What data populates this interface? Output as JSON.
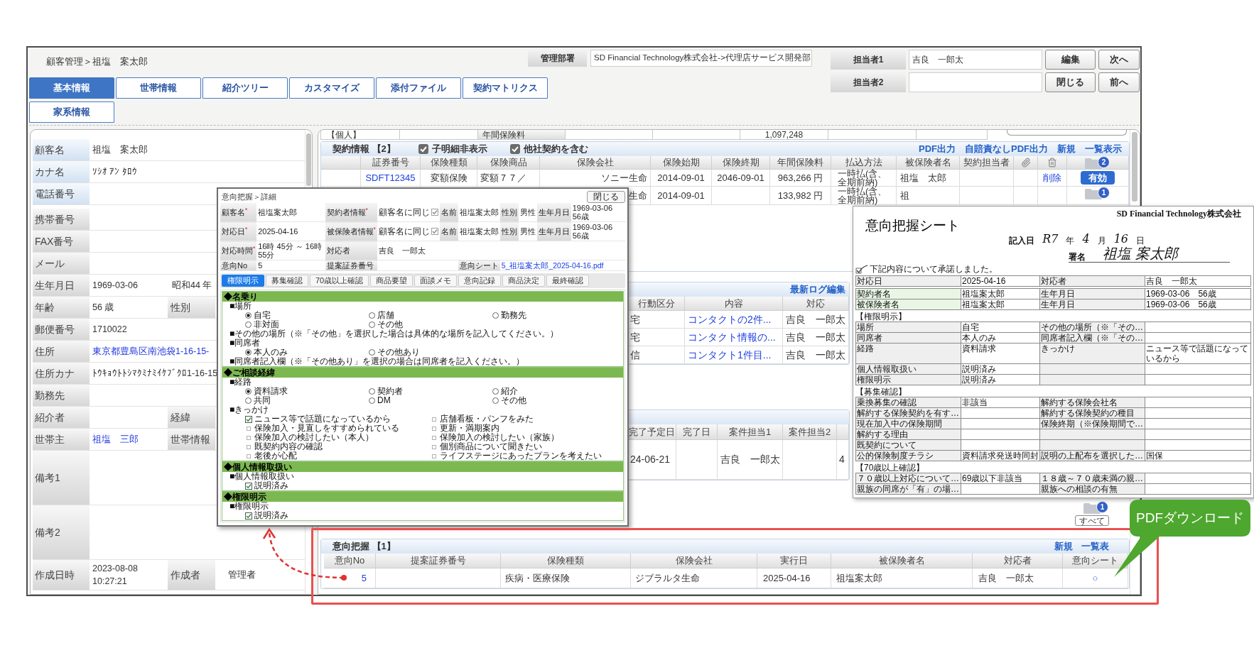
{
  "breadcrumb": "顧客管理＞祖塩　案太郎",
  "department": {
    "label": "管理部署",
    "value": "SD Financial Technology株式会社->代理店サービス開発部"
  },
  "staff": [
    {
      "label": "担当者1",
      "value": "吉良　一郎太"
    },
    {
      "label": "担当者2"
    }
  ],
  "buttons": [
    "編集",
    "次へ",
    "閉じる",
    "前へ"
  ],
  "tabs": [
    {
      "label": "基本情報",
      "selected": true
    },
    {
      "label": "世帯情報",
      "selected": false
    },
    {
      "label": "紹介ツリー",
      "selected": false
    },
    {
      "label": "カスタマイズ",
      "selected": false
    },
    {
      "label": "添付ファイル",
      "selected": false
    },
    {
      "label": "契約マトリクス",
      "selected": false
    },
    {
      "label": "家系情報",
      "selected": false
    }
  ],
  "customer": {
    "rows": [
      {
        "label": "顧客名",
        "kind": "field",
        "highlighted": true,
        "value": "祖塩　案太郎",
        "link": false
      },
      {
        "label": "カナ名",
        "kind": "field",
        "highlighted": true,
        "value": "ｿｼｵ ｱﾝ ﾀﾛｳ",
        "link": false
      },
      {
        "label": "電話番号",
        "kind": "field",
        "highlighted": true
      },
      {
        "label": "携帯番号",
        "kind": "field",
        "highlighted": false
      },
      {
        "label": "FAX番号",
        "kind": "field",
        "highlighted": false
      },
      {
        "label": "メール",
        "kind": "field",
        "highlighted": false
      },
      {
        "label": "生年月日",
        "kind": "field",
        "highlighted": false,
        "value": "1969-03-06",
        "link": false,
        "second_value": "昭和44 年"
      },
      {
        "label": "年齢",
        "kind": "field",
        "highlighted": false,
        "value": "56 歳",
        "link": false,
        "second_label": "性別"
      },
      {
        "label": "郵便番号",
        "kind": "field",
        "highlighted": false,
        "value": "1710022",
        "link": false
      },
      {
        "label": "住所",
        "kind": "field",
        "highlighted": false,
        "value": "東京都豊島区南池袋1-16-15-",
        "link": true
      },
      {
        "label": "住所カナ",
        "kind": "field",
        "highlighted": false,
        "value": "ﾄｳｷｮｳﾄﾄｼﾏｸﾐﾅﾐｲｹﾌﾞｸﾛ1-16-15",
        "link": false
      },
      {
        "label": "勤務先",
        "kind": "field",
        "highlighted": false
      },
      {
        "label": "紹介者",
        "kind": "field",
        "highlighted": false,
        "second_label": "経緯"
      },
      {
        "label": "世帯主",
        "kind": "field",
        "highlighted": false,
        "value": "祖塩　三郎",
        "link": true,
        "second_label": "世帯情報"
      },
      {
        "label": "備考1",
        "kind": "note",
        "highlighted": false
      },
      {
        "label": "備考2",
        "kind": "note",
        "highlighted": false
      },
      {
        "label": "作成日時",
        "kind": "field",
        "highlighted": false,
        "value": "2023-08-08 10:27:21",
        "link": false,
        "second_label": "作成者",
        "second_value": "管理者"
      }
    ]
  },
  "summary": {
    "category": "【個人】",
    "premium_label": "年間保険料",
    "premium_total": "1,097,248"
  },
  "contracts": {
    "title": "契約情報 【2】",
    "options": [
      {
        "label": "子明細非表示",
        "checked": true
      },
      {
        "label": "他社契約を含む",
        "checked": true
      }
    ],
    "links": [
      "PDF出力",
      "自賠責なしPDF出力",
      "新規",
      "一覧表示"
    ],
    "columns": [
      "証券番号",
      "保険種類",
      "保険商品",
      "保険会社",
      "保険始期",
      "保険終期",
      "年間保険料",
      "払込方法",
      "被保険者名",
      "契約担当者"
    ],
    "count_badge": "2",
    "rows": [
      {
        "policy_no": "SDFT12345",
        "type": "変額保険",
        "product": "変額７７／",
        "company": "ソニー生命",
        "start": "2014-09-01",
        "end": "2046-09-01",
        "premium": "963,266 円",
        "payment": "一時払(含、全期前納)",
        "insured": "祖塩　太郎",
        "action": "削除",
        "status": "有効"
      },
      {
        "company": "生命",
        "start": "2014-09-01",
        "premium": "133,982 円",
        "payment": "一時払(含、全期前納)",
        "insured": "祖",
        "badge": "1"
      }
    ]
  },
  "activity_log": {
    "link": "最新ログ編集",
    "columns": [
      "行動区分",
      "内容",
      "対応"
    ],
    "rows": [
      {
        "type": "宅",
        "content": "コンタクトの2件...",
        "staff": "吉良　一郎太"
      },
      {
        "type": "宅",
        "content": "コンタクト情報の...",
        "staff": "吉良　一郎太"
      },
      {
        "type": "信",
        "content": "コンタクト1件目...",
        "staff": "吉良　一郎太"
      }
    ]
  },
  "cases": {
    "columns": [
      "完了予定日",
      "完了日",
      "案件担当1",
      "案件担当2"
    ],
    "rows": [
      {
        "planned": "24-06-21",
        "staff1": "吉良　一郎太",
        "column_5": "4"
      }
    ],
    "badge": "1",
    "all_button": "すべて"
  },
  "intentions": {
    "title": "意向把握 【1】",
    "links": [
      "新規",
      "一覧表"
    ],
    "columns": [
      "意向No",
      "提案証券番号",
      "保険種類",
      "保険会社",
      "実行日",
      "被保険者名",
      "対応者",
      "意向シート"
    ],
    "rows": [
      {
        "no": "5",
        "type": "疾病・医療保険",
        "company": "ジブラルタ生命",
        "date": "2025-04-16",
        "insured": "祖塩案太郎",
        "staff": "吉良　一郎太",
        "sheet": "○"
      }
    ]
  },
  "detail": {
    "breadcrumb": "意向把握＞詳細",
    "close": "閉じる",
    "info": [
      [
        {
          "kind": "label",
          "text": "顧客名$^{*}$"
        },
        {
          "kind": "value",
          "text": "祖塩案太郎"
        },
        {
          "kind": "label",
          "text": "契約者情報$^{*}$"
        },
        {
          "kind": "check",
          "text": "顧客名に同じ",
          "checked": true
        },
        {
          "kind": "label",
          "text": "名前"
        },
        {
          "kind": "value",
          "text": "祖塩案太郎"
        },
        {
          "kind": "label",
          "text": "性別"
        },
        {
          "kind": "value",
          "text": "男性"
        },
        {
          "kind": "label",
          "text": "生年月日"
        },
        {
          "kind": "value",
          "text": "1969-03-06　56歳"
        }
      ],
      [
        {
          "kind": "label",
          "text": "対応日$^{*}$"
        },
        {
          "kind": "value",
          "text": "2025-04-16"
        },
        {
          "kind": "label",
          "text": "被保険者情報$^{*}$"
        },
        {
          "kind": "check",
          "text": "顧客名に同じ",
          "checked": true
        },
        {
          "kind": "label",
          "text": "名前"
        },
        {
          "kind": "value",
          "text": "祖塩案太郎"
        },
        {
          "kind": "label",
          "text": "性別"
        },
        {
          "kind": "value",
          "text": "男性"
        },
        {
          "kind": "label",
          "text": "生年月日"
        },
        {
          "kind": "value",
          "text": "1969-03-06　56歳"
        }
      ],
      [
        {
          "kind": "label",
          "text": "対応時間$^{*}$"
        },
        {
          "kind": "value",
          "text": "16時 45分 ～ 16時 55分"
        },
        {
          "kind": "label",
          "text": "対応者"
        },
        {
          "kind": "value",
          "text": "吉良　一郎太"
        }
      ],
      [
        {
          "kind": "label",
          "text": "意向No"
        },
        {
          "kind": "value",
          "text": "5"
        },
        {
          "kind": "label",
          "text": "提案証券番号"
        },
        {
          "kind": "blank"
        },
        {
          "kind": "blank"
        },
        {
          "kind": "label",
          "text": "意向シート"
        },
        {
          "kind": "link",
          "text": "5_祖塩案太郎_2025-04-16.pdf"
        }
      ]
    ],
    "tabs": [
      {
        "label": "権限明示",
        "selected": true
      },
      {
        "label": "募集確認",
        "selected": false
      },
      {
        "label": "70歳以上確認",
        "selected": false
      },
      {
        "label": "商品要望",
        "selected": false
      },
      {
        "label": "面談メモ",
        "selected": false
      },
      {
        "label": "意向記録",
        "selected": false
      },
      {
        "label": "商品決定",
        "selected": false
      },
      {
        "label": "最終確認",
        "selected": false
      }
    ],
    "sections": [
      {
        "title": "◆名乗り",
        "items": [
          {
            "kind": "heading",
            "text": "■場所"
          },
          {
            "kind": "radios",
            "options": [
              {
                "label": "自宅",
                "selected": true
              },
              {
                "label": "店舗",
                "selected": false
              },
              {
                "label": "勤務先",
                "selected": false
              },
              {
                "label": "非対面",
                "selected": false
              },
              {
                "label": "その他",
                "selected": false
              }
            ]
          },
          {
            "kind": "heading",
            "text": "■その他の場所（※「その他」を選択した場合は具体的な場所を記入してください。）"
          },
          {
            "kind": "heading",
            "text": "■同席者"
          },
          {
            "kind": "radios",
            "options": [
              {
                "label": "本人のみ",
                "selected": true
              },
              {
                "label": "その他あり",
                "selected": false
              }
            ]
          },
          {
            "kind": "heading",
            "text": "■同席者記入欄（※「その他あり」を選択の場合は同席者を記入ください。）"
          }
        ]
      },
      {
        "title": "◆ご相談経緯",
        "items": [
          {
            "kind": "heading",
            "text": "■経路"
          },
          {
            "kind": "radios",
            "options": [
              {
                "label": "資料請求",
                "selected": true
              },
              {
                "label": "契約者",
                "selected": false
              },
              {
                "label": "紹介",
                "selected": false
              },
              {
                "label": "共同",
                "selected": false
              },
              {
                "label": "DM",
                "selected": false
              },
              {
                "label": "その他",
                "selected": false
              }
            ]
          },
          {
            "kind": "heading",
            "text": "■きっかけ"
          },
          {
            "kind": "checks",
            "options": [
              {
                "label": "ニュース等で話題になっているから",
                "checked": true
              },
              {
                "label": "店舗看板・パンフをみた",
                "checked": false
              },
              {
                "label": "保険加入・見直しをすすめられている",
                "checked": false
              },
              {
                "label": "更新・満期案内",
                "checked": false
              },
              {
                "label": "保険加入の検討したい（本人）",
                "checked": false
              },
              {
                "label": "保険加入の検討したい（家族）",
                "checked": false
              },
              {
                "label": "既契約内容の確認",
                "checked": false
              },
              {
                "label": "個別商品について聞きたい",
                "checked": false
              },
              {
                "label": "老後が心配",
                "checked": false
              },
              {
                "label": "ライフステージにあったプランを考えたい",
                "checked": false
              }
            ]
          }
        ]
      },
      {
        "title": "◆個人情報取扱い",
        "items": [
          {
            "kind": "heading",
            "text": "■個人情報取扱い"
          },
          {
            "kind": "checks",
            "options": [
              {
                "label": "説明済み",
                "checked": true
              }
            ]
          }
        ]
      },
      {
        "title": "◆権限明示",
        "items": [
          {
            "kind": "heading",
            "text": "■権限明示"
          },
          {
            "kind": "checks",
            "options": [
              {
                "label": "説明済み",
                "checked": true
              }
            ]
          }
        ]
      }
    ]
  },
  "sheet": {
    "company": "SD Financial Technology株式会社",
    "title": "意向把握シート",
    "date": {
      "label": "記入日",
      "parts": [
        {
          "hand": "R7",
          "unit": "年"
        },
        {
          "hand": "4",
          "unit": "月"
        },
        {
          "hand": "16",
          "unit": "日"
        }
      ]
    },
    "signature": {
      "label": "署名",
      "hand": "祖塩 案太郎"
    },
    "consent": {
      "text": "下記内容について承諾しました。",
      "checked": true
    },
    "tables": [
      {
        "tinted": false,
        "rows": [
          [
            "対応日",
            "2025-04-16",
            "対応者",
            "吉良　一郎太"
          ]
        ]
      },
      {
        "tinted": true,
        "rows": [
          [
            "契約者名",
            "祖塩案太郎",
            "生年月日",
            "1969-03-06　56歳"
          ],
          [
            "被保険者名",
            "祖塩案太郎",
            "生年月日",
            "1969-03-06　56歳"
          ]
        ]
      },
      {
        "tinted": false,
        "heading": "【権限明示】",
        "rows": [
          [
            "場所",
            "自宅",
            "その他の場所（※「その…",
            null
          ],
          [
            "同席者",
            "本人のみ",
            "同席者記入欄（※「その…",
            null
          ],
          [
            "経路",
            "資料請求",
            "きっかけ",
            "ニュース等で話題になっているから"
          ],
          [
            "個人情報取扱い",
            "説明済み",
            null,
            null
          ],
          [
            "権限明示",
            "説明済み",
            null,
            null
          ]
        ]
      },
      {
        "tinted": false,
        "heading": "【募集確認】",
        "rows": [
          [
            "乗換募集の確認",
            "非該当",
            "解約する保険会社名",
            null
          ],
          [
            "解約する保険契約を有す…",
            null,
            "解約する保険契約の種目",
            null
          ],
          [
            "現在加入中の保険期間",
            null,
            "保険終期（※保険期間で…",
            null
          ],
          [
            "解約する理由",
            null,
            null,
            null
          ],
          [
            "既契約について",
            null,
            null,
            null
          ],
          [
            "公的保険制度チラシ",
            "資料請求発送時同封",
            "説明の上配布を選択した…",
            "国保"
          ]
        ]
      },
      {
        "tinted": false,
        "heading": "【70歳以上確認】",
        "rows": [
          [
            "７０歳以上対応について…",
            "69歳以下非該当",
            "１８歳～７０歳未満の親…",
            null
          ],
          [
            "親族の同席が「有」の場…",
            null,
            "親族への相談の有無",
            null
          ]
        ]
      }
    ]
  },
  "callout": {
    "text": "PDFダウンロード"
  }
}
